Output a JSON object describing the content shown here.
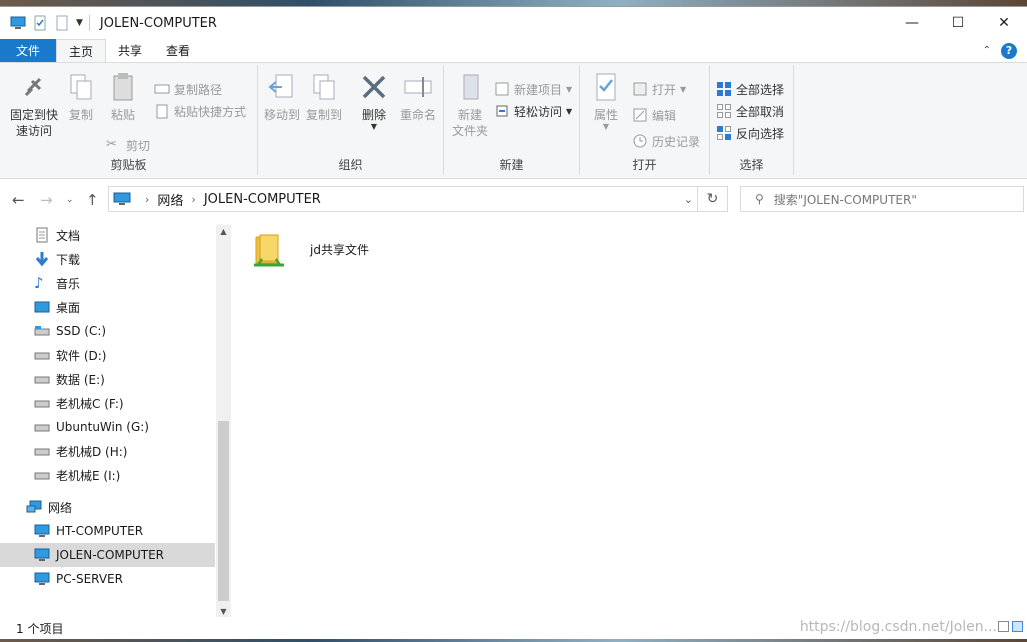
{
  "window": {
    "title": "JOLEN-COMPUTER"
  },
  "title_controls": {
    "minimize": "—",
    "maximize": "☐",
    "close": "✕"
  },
  "tabs": [
    {
      "label": "文件"
    },
    {
      "label": "主页"
    },
    {
      "label": "共享"
    },
    {
      "label": "查看"
    }
  ],
  "ribbon": {
    "clipboard": {
      "label": "剪贴板",
      "pin_line1": "固定到快",
      "pin_line2": "速访问",
      "copy": "复制",
      "paste": "粘贴",
      "copy_path": "复制路径",
      "paste_shortcut": "粘贴快捷方式",
      "cut": "剪切"
    },
    "organize": {
      "label": "组织",
      "move_to": "移动到",
      "copy_to": "复制到",
      "delete": "删除",
      "rename": "重命名"
    },
    "new": {
      "label": "新建",
      "new_folder_line1": "新建",
      "new_folder_line2": "文件夹",
      "new_item": "新建项目",
      "easy_access": "轻松访问"
    },
    "open": {
      "label": "打开",
      "properties": "属性",
      "open": "打开",
      "edit": "编辑",
      "history": "历史记录"
    },
    "select": {
      "label": "选择",
      "select_all": "全部选择",
      "select_none": "全部取消",
      "invert": "反向选择"
    }
  },
  "address": {
    "crumbs": [
      "网络",
      "JOLEN-COMPUTER"
    ],
    "search_placeholder": "搜索\"JOLEN-COMPUTER\""
  },
  "nav": {
    "items": [
      {
        "label": "文档",
        "icon": "document-icon"
      },
      {
        "label": "下载",
        "icon": "download-icon"
      },
      {
        "label": "音乐",
        "icon": "music-icon"
      },
      {
        "label": "桌面",
        "icon": "desktop-icon"
      },
      {
        "label": "SSD (C:)",
        "icon": "drive-icon"
      },
      {
        "label": "软件 (D:)",
        "icon": "drive-icon"
      },
      {
        "label": "数据 (E:)",
        "icon": "drive-icon"
      },
      {
        "label": "老机械C (F:)",
        "icon": "drive-icon"
      },
      {
        "label": "UbuntuWin (G:)",
        "icon": "drive-icon"
      },
      {
        "label": "老机械D (H:)",
        "icon": "drive-icon"
      },
      {
        "label": "老机械E (I:)",
        "icon": "drive-icon"
      },
      {
        "label": "网络",
        "icon": "network-icon"
      },
      {
        "label": "HT-COMPUTER",
        "icon": "computer-icon"
      },
      {
        "label": "JOLEN-COMPUTER",
        "icon": "computer-icon"
      },
      {
        "label": "PC-SERVER",
        "icon": "computer-icon"
      }
    ]
  },
  "content": {
    "items": [
      {
        "label": "jd共享文件",
        "icon": "shared-folder-icon"
      }
    ]
  },
  "status": {
    "count": "1 个项目",
    "watermark": "https://blog.csdn.net/Jolen..."
  }
}
